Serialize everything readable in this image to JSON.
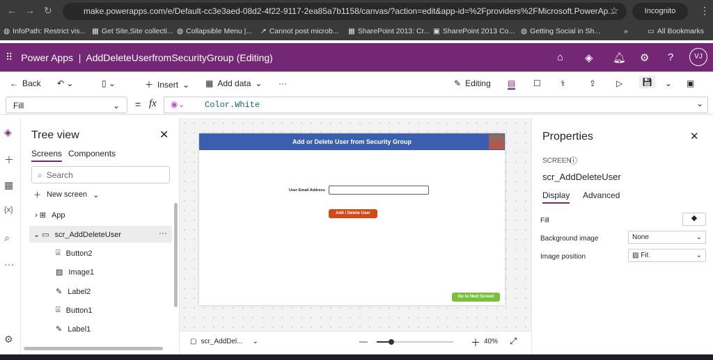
{
  "browser": {
    "url": "make.powerapps.com/e/Default-cc3e3aed-08d2-4f22-9117-2ea85a7b1158/canvas/?action=edit&app-id=%2Fproviders%2FMicrosoft.PowerAp...",
    "incognito": "Incognito",
    "bookmarks": [
      "InfoPath: Restrict vis...",
      "Get Site,Site collecti...",
      "Collapsible Menu |...",
      "Cannot post microb...",
      "SharePoint 2013: Cr...",
      "SharePoint 2013 Co...",
      "Getting Social in Sh..."
    ],
    "more": "»",
    "all_bookmarks": "All Bookmarks"
  },
  "app": {
    "title": "Power Apps  |  AddDeleteUserfromSecurityGroup (Editing)",
    "avatar": "VJ"
  },
  "toolbar": {
    "back": "Back",
    "insert": "Insert",
    "add_data": "Add data",
    "more": "···",
    "editing": "Editing"
  },
  "formula": {
    "property": "Fill",
    "fx": "fx",
    "value": "Color.White"
  },
  "tree": {
    "title": "Tree view",
    "tabs": [
      "Screens",
      "Components"
    ],
    "search_placeholder": "Search",
    "new_screen": "New screen",
    "app": "App",
    "screen": "scr_AddDeleteUser",
    "children": [
      "Button2",
      "Image1",
      "Label2",
      "Button1",
      "Label1"
    ]
  },
  "canvas": {
    "header": "Add or Delete User from Security Group",
    "email_label": "User Email Address",
    "add_button": "Add / Delete User",
    "next_button": "Go to Next Screen",
    "screen_selector": "scr_AddDel...",
    "zoom": "40%"
  },
  "properties": {
    "title": "Properties",
    "type": "SCREEN",
    "name": "scr_AddDeleteUser",
    "tabs": [
      "Display",
      "Advanced"
    ],
    "fill_label": "Fill",
    "bg_label": "Background image",
    "bg_value": "None",
    "pos_label": "Image position",
    "pos_value": "Fit"
  },
  "colors": {
    "brand": "#742774",
    "header": "#3b5fae",
    "add_button": "#d34a1a",
    "next_button": "#7bbf3c"
  }
}
